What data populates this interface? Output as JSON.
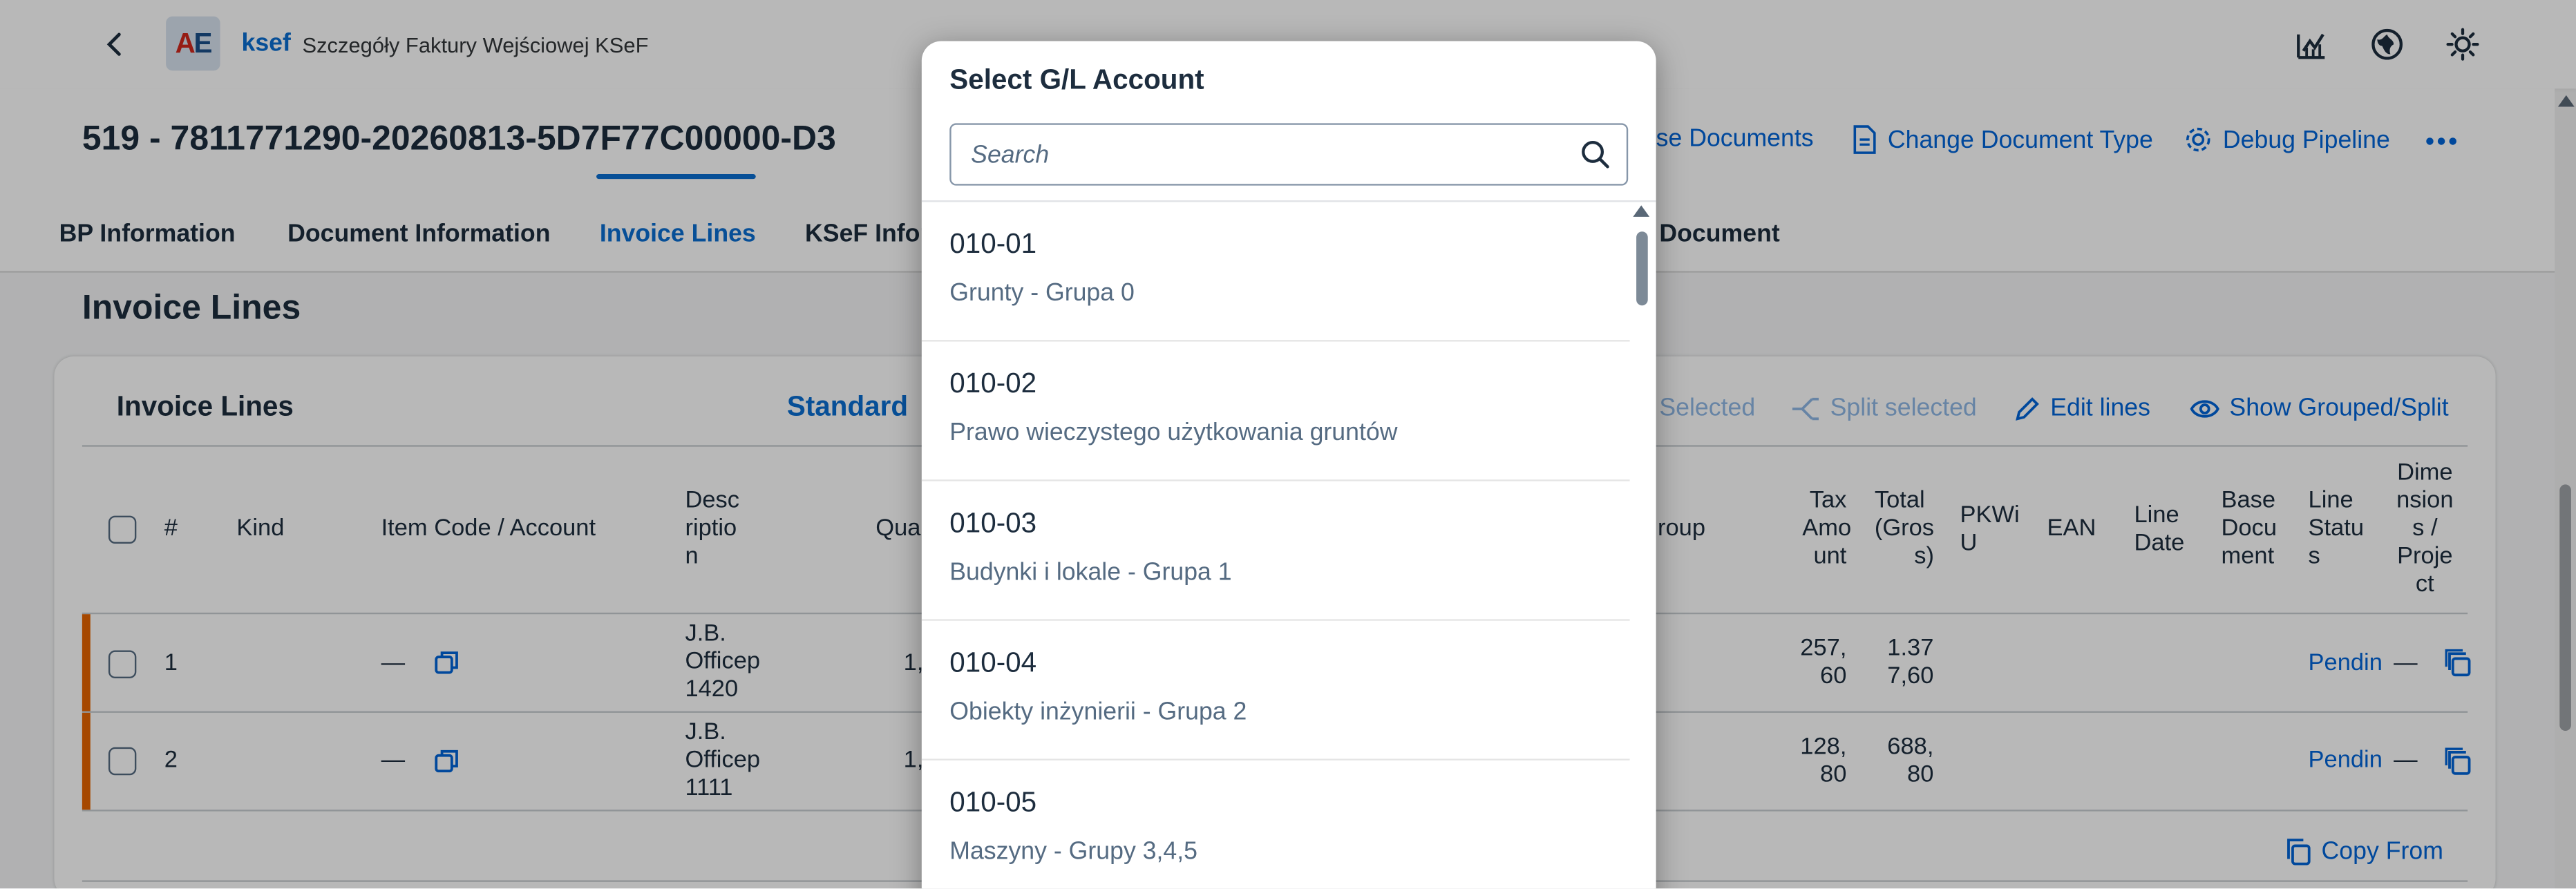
{
  "shell": {
    "logo_text_a": "A",
    "logo_text_e": "E",
    "app_name": "ksef",
    "app_subtitle": "Szczegóły Faktury Wejściowej KSeF",
    "icons": [
      "back-chevron-icon",
      "chart-icon",
      "globe-icon",
      "sun-icon"
    ]
  },
  "header": {
    "title": "519 - 7811771290-20260813-5D7F77C00000-D3",
    "actions": {
      "close_documents": "se Documents",
      "change_document_type": "Change Document Type",
      "debug_pipeline": "Debug Pipeline"
    }
  },
  "tabs": [
    {
      "label": "BP Information"
    },
    {
      "label": "Document Information"
    },
    {
      "label": "Invoice Lines"
    },
    {
      "label": "KSeF Infor"
    },
    {
      "label": "Document"
    }
  ],
  "section": {
    "title": "Invoice Lines"
  },
  "table": {
    "title": "Invoice Lines",
    "variant": "Standard",
    "toolbar": {
      "delete_selected": "Selected",
      "split_selected": "Split selected",
      "edit_lines": "Edit lines",
      "show_grouped": "Show Grouped/Split",
      "copy_from": "Copy From"
    },
    "columns": {
      "num": "#",
      "kind": "Kind",
      "item_code": "Item Code / Account",
      "desc_1": "Desc",
      "desc_2": "riptio",
      "desc_3": "n",
      "qty": "Qua",
      "group": "roup",
      "tax_1": "Tax",
      "tax_2": "Amo",
      "tax_3": "unt",
      "total_1": "Total",
      "total_2": "(Gros",
      "total_3": "s)",
      "pkwiu_1": "PKWi",
      "pkwiu_2": "U",
      "ean": "EAN",
      "line_date_1": "Line",
      "line_date_2": "Date",
      "base_doc_1": "Base",
      "base_doc_2": "Docu",
      "base_doc_3": "ment",
      "line_status_1": "Line",
      "line_status_2": "Statu",
      "line_status_3": "s",
      "dim_1": "Dime",
      "dim_2": "nsion",
      "dim_3": "s /",
      "dim_4": "Proje",
      "dim_5": "ct"
    },
    "rows": [
      {
        "num": "1",
        "item_code": "—",
        "desc_1": "J.B.",
        "desc_2": "Officep",
        "desc_3": "1420",
        "qty": "1,",
        "tax_1": "257,",
        "tax_2": "60",
        "total_1": "1.37",
        "total_2": "7,60",
        "status": "Pendin",
        "dim": "—"
      },
      {
        "num": "2",
        "item_code": "—",
        "desc_1": "J.B.",
        "desc_2": "Officep",
        "desc_3": "1111",
        "qty": "1,",
        "tax_1": "128,",
        "tax_2": "80",
        "total_1": "688,",
        "total_2": "80",
        "status": "Pendin",
        "dim": "—"
      }
    ]
  },
  "dialog": {
    "title": "Select G/L Account",
    "search_placeholder": "Search",
    "items": [
      {
        "code": "010-01",
        "name": "Grunty - Grupa 0"
      },
      {
        "code": "010-02",
        "name": "Prawo wieczystego użytkowania gruntów"
      },
      {
        "code": "010-03",
        "name": "Budynki i lokale - Grupa 1"
      },
      {
        "code": "010-04",
        "name": "Obiekty inżynierii - Grupa 2"
      },
      {
        "code": "010-05",
        "name": "Maszyny - Grupy 3,4,5"
      }
    ]
  }
}
